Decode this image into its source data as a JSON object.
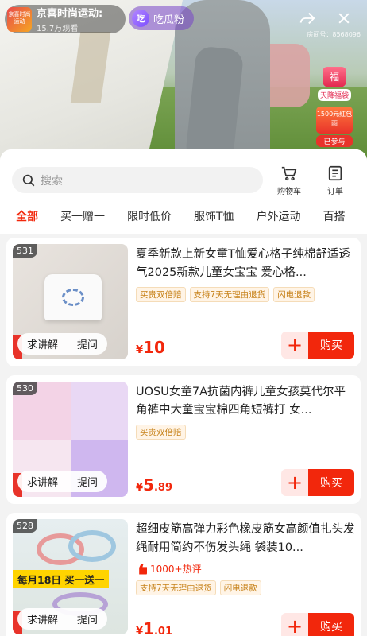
{
  "live": {
    "host_avatar_text": "京喜时尚运动",
    "host_name": "京喜时尚运动:",
    "viewers": "15.7万观看",
    "fan_button": "吃瓜粉",
    "fan_icon_text": "吃",
    "share_icon": "share-icon",
    "close_icon": "close-icon",
    "room_id": "房间号：8568096",
    "gift_bag_text": "福",
    "gift_label": "天降福袋",
    "coupon_text": "1500元红包雨",
    "coupon_label": "已参与"
  },
  "search": {
    "placeholder": "搜索"
  },
  "actions": {
    "cart": "购物车",
    "orders": "订单"
  },
  "tabs": [
    "全部",
    "买一赠一",
    "限时低价",
    "服饰T恤",
    "户外运动",
    "百搭"
  ],
  "thumb_buttons": {
    "explain": "求讲解",
    "ask": "提问"
  },
  "buy_label": "购买",
  "add_label": "+",
  "products": [
    {
      "index": "531",
      "title": "夏季新款上新女童T恤爱心格子纯棉舒适透气2025新款儿童女宝宝 爱心格...",
      "badges": [
        "买贵双倍赔",
        "支持7天无理由退货",
        "闪电退款"
      ],
      "price_symbol": "¥",
      "price_int": "10",
      "price_dec": ""
    },
    {
      "index": "530",
      "title": "UOSU女童7A抗菌内裤儿童女孩莫代尔平角裤中大童宝宝棉四角短裤打 女...",
      "badges": [
        "买贵双倍赔"
      ],
      "price_symbol": "¥",
      "price_int": "5",
      "price_dec": ".89"
    },
    {
      "index": "528",
      "title": "超细皮筋高弹力彩色橡皮筋女高颜值扎头发绳耐用简约不伤发头绳 袋装10...",
      "hot": "1000+热评",
      "promo": "每月18日 买一送一",
      "badges": [
        "支持7天无理由退货",
        "闪电退款"
      ],
      "price_symbol": "¥",
      "price_int": "1",
      "price_dec": ".01"
    }
  ]
}
